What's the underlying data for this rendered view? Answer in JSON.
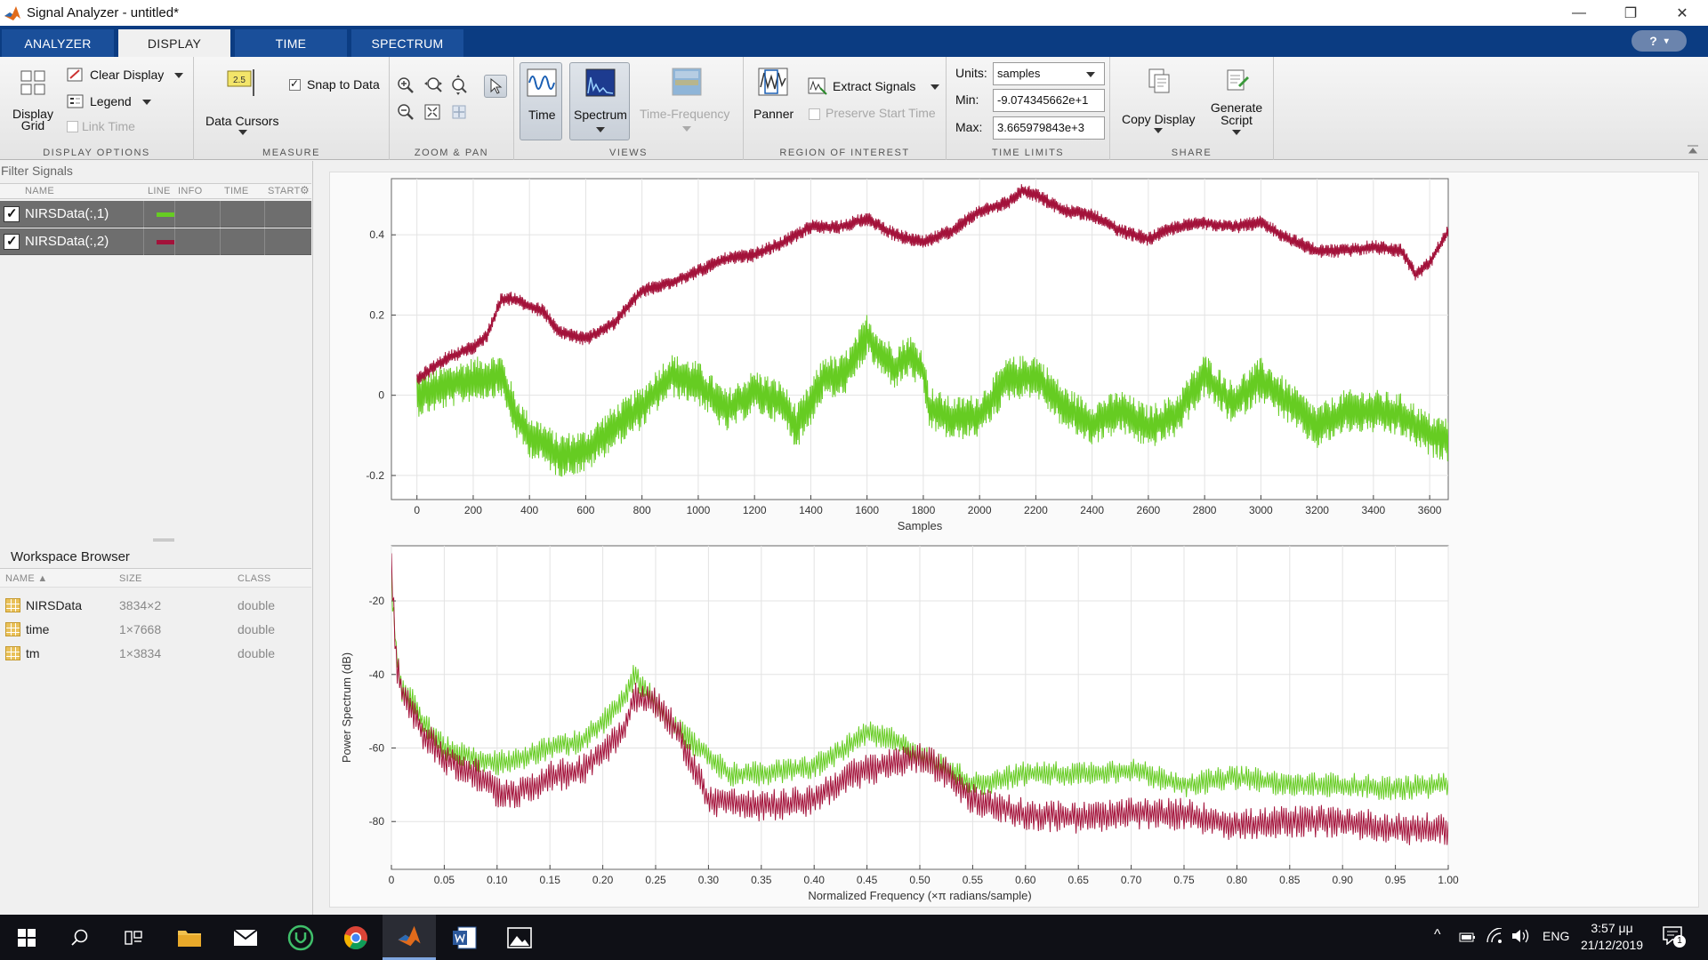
{
  "window": {
    "title": "Signal Analyzer - untitled*",
    "minimize": "—",
    "maximize": "❐",
    "close": "✕"
  },
  "tabs": [
    {
      "label": "ANALYZER",
      "active": false
    },
    {
      "label": "DISPLAY",
      "active": true
    },
    {
      "label": "TIME",
      "active": false
    },
    {
      "label": "SPECTRUM",
      "active": false
    }
  ],
  "help_icon": "?",
  "ribbon": {
    "display_options": {
      "label": "DISPLAY OPTIONS",
      "display_grid": "Display Grid",
      "clear_display": "Clear Display",
      "legend": "Legend",
      "link_time": "Link Time"
    },
    "measure": {
      "label": "MEASURE",
      "data_cursors": "Data Cursors",
      "cursor_badge": "2.5",
      "snap_to_data": "Snap to Data"
    },
    "zoom_pan": {
      "label": "ZOOM & PAN"
    },
    "views": {
      "label": "VIEWS",
      "time": "Time",
      "spectrum": "Spectrum",
      "time_frequency": "Time-Frequency"
    },
    "roi": {
      "label": "REGION OF INTEREST",
      "panner": "Panner",
      "extract_signals": "Extract Signals",
      "preserve_start_time": "Preserve Start Time"
    },
    "time_limits": {
      "label": "TIME LIMITS",
      "units_label": "Units:",
      "units_value": "samples",
      "min_label": "Min:",
      "min_value": "-9.074345662e+1",
      "max_label": "Max:",
      "max_value": "3.665979843e+3"
    },
    "share": {
      "label": "SHARE",
      "copy_display": "Copy Display",
      "generate_script_l1": "Generate",
      "generate_script_l2": "Script"
    }
  },
  "signals_panel": {
    "filter_placeholder": "Filter Signals",
    "columns": [
      "NAME",
      "LINE",
      "INFO",
      "TIME",
      "START"
    ],
    "rows": [
      {
        "name": "NIRSData(:,1)",
        "color": "#66cc22"
      },
      {
        "name": "NIRSData(:,2)",
        "color": "#a3123a"
      }
    ]
  },
  "workspace": {
    "title": "Workspace Browser",
    "columns": [
      "NAME ▲",
      "SIZE",
      "CLASS"
    ],
    "rows": [
      {
        "name": "NIRSData",
        "size": "3834×2",
        "class": "double"
      },
      {
        "name": "time",
        "size": "1×7668",
        "class": "double"
      },
      {
        "name": "tm",
        "size": "1×3834",
        "class": "double"
      }
    ]
  },
  "chart_data": [
    {
      "type": "line",
      "title": "",
      "xlabel": "Samples",
      "ylabel": "",
      "xlim": [
        -90.74,
        3666
      ],
      "ylim": [
        -0.26,
        0.54
      ],
      "xticks": [
        0,
        200,
        400,
        600,
        800,
        1000,
        1200,
        1400,
        1600,
        1800,
        2000,
        2200,
        2400,
        2600,
        2800,
        3000,
        3200,
        3400,
        3600
      ],
      "yticks": [
        -0.2,
        0,
        0.2,
        0.4
      ],
      "ytick_labels": [
        "-0.2",
        "0",
        "0.2",
        "0.4"
      ],
      "grid": true,
      "series": [
        {
          "color": "#66cc22",
          "noise_amplitude": 0.055,
          "x": [
            0,
            100,
            200,
            300,
            350,
            400,
            450,
            500,
            600,
            700,
            800,
            900,
            1000,
            1100,
            1200,
            1300,
            1350,
            1400,
            1450,
            1500,
            1550,
            1600,
            1650,
            1700,
            1750,
            1800,
            1820,
            1900,
            2000,
            2100,
            2200,
            2300,
            2400,
            2500,
            2600,
            2700,
            2800,
            2900,
            3000,
            3100,
            3200,
            3300,
            3400,
            3500,
            3600,
            3666
          ],
          "y": [
            0.0,
            0.02,
            0.04,
            0.05,
            -0.05,
            -0.1,
            -0.12,
            -0.15,
            -0.14,
            -0.08,
            -0.03,
            0.05,
            0.03,
            -0.04,
            0.01,
            -0.02,
            -0.08,
            -0.02,
            0.05,
            0.04,
            0.08,
            0.15,
            0.1,
            0.07,
            0.1,
            0.06,
            -0.03,
            -0.06,
            -0.05,
            0.04,
            0.05,
            -0.03,
            -0.07,
            -0.04,
            -0.08,
            -0.05,
            0.05,
            -0.02,
            0.04,
            -0.02,
            -0.08,
            -0.04,
            -0.04,
            -0.05,
            -0.1,
            -0.11
          ]
        },
        {
          "color": "#a3123a",
          "noise_amplitude": 0.018,
          "x": [
            0,
            100,
            200,
            250,
            300,
            350,
            400,
            450,
            500,
            600,
            700,
            800,
            900,
            1000,
            1100,
            1200,
            1300,
            1400,
            1500,
            1600,
            1700,
            1800,
            1900,
            2000,
            2100,
            2150,
            2200,
            2300,
            2400,
            2500,
            2600,
            2700,
            2800,
            2900,
            3000,
            3100,
            3200,
            3300,
            3400,
            3500,
            3550,
            3600,
            3666
          ],
          "y": [
            0.04,
            0.09,
            0.12,
            0.15,
            0.24,
            0.24,
            0.22,
            0.21,
            0.16,
            0.14,
            0.18,
            0.26,
            0.28,
            0.31,
            0.34,
            0.35,
            0.38,
            0.42,
            0.42,
            0.44,
            0.4,
            0.38,
            0.41,
            0.46,
            0.48,
            0.51,
            0.5,
            0.46,
            0.45,
            0.41,
            0.39,
            0.42,
            0.43,
            0.42,
            0.43,
            0.39,
            0.36,
            0.36,
            0.37,
            0.36,
            0.3,
            0.33,
            0.41
          ]
        }
      ]
    },
    {
      "type": "line",
      "title": "",
      "xlabel": "Normalized Frequency (×π radians/sample)",
      "ylabel": "Power Spectrum (dB)",
      "xlim": [
        0,
        1
      ],
      "ylim": [
        -93,
        -5
      ],
      "xticks": [
        0,
        0.05,
        0.1,
        0.15,
        0.2,
        0.25,
        0.3,
        0.35,
        0.4,
        0.45,
        0.5,
        0.55,
        0.6,
        0.65,
        0.7,
        0.75,
        0.8,
        0.85,
        0.9,
        0.95,
        1.0
      ],
      "xtick_labels": [
        "0",
        "0.05",
        "0.10",
        "0.15",
        "0.20",
        "0.25",
        "0.30",
        "0.35",
        "0.40",
        "0.45",
        "0.50",
        "0.55",
        "0.60",
        "0.65",
        "0.70",
        "0.75",
        "0.80",
        "0.85",
        "0.90",
        "0.95",
        "1.00"
      ],
      "yticks": [
        -80,
        -60,
        -40,
        -20
      ],
      "ytick_labels": [
        "-80",
        "-60",
        "-40",
        "-20"
      ],
      "grid": true,
      "series": [
        {
          "color": "#66cc22",
          "noise_amplitude": 3.5,
          "x": [
            0,
            0.005,
            0.01,
            0.02,
            0.03,
            0.05,
            0.08,
            0.1,
            0.12,
            0.15,
            0.18,
            0.2,
            0.22,
            0.23,
            0.25,
            0.27,
            0.3,
            0.32,
            0.35,
            0.38,
            0.4,
            0.43,
            0.45,
            0.48,
            0.5,
            0.53,
            0.55,
            0.6,
            0.65,
            0.7,
            0.75,
            0.8,
            0.85,
            0.9,
            0.95,
            1.0
          ],
          "y": [
            -15,
            -35,
            -44,
            -47,
            -53,
            -60,
            -63,
            -64,
            -63,
            -60,
            -58,
            -53,
            -47,
            -40,
            -48,
            -55,
            -62,
            -67,
            -67,
            -66,
            -65,
            -60,
            -56,
            -58,
            -62,
            -66,
            -70,
            -67,
            -67,
            -66,
            -70,
            -68,
            -70,
            -70,
            -71,
            -70
          ]
        },
        {
          "color": "#a3123a",
          "noise_amplitude": 4.5,
          "x": [
            0,
            0.005,
            0.01,
            0.02,
            0.03,
            0.05,
            0.08,
            0.1,
            0.12,
            0.15,
            0.18,
            0.2,
            0.22,
            0.23,
            0.25,
            0.27,
            0.3,
            0.32,
            0.35,
            0.38,
            0.4,
            0.43,
            0.45,
            0.48,
            0.5,
            0.53,
            0.55,
            0.6,
            0.65,
            0.7,
            0.75,
            0.8,
            0.85,
            0.9,
            0.95,
            1.0
          ],
          "y": [
            -10,
            -38,
            -45,
            -50,
            -56,
            -63,
            -67,
            -72,
            -72,
            -68,
            -66,
            -61,
            -55,
            -46,
            -48,
            -55,
            -74,
            -75,
            -76,
            -75,
            -74,
            -68,
            -66,
            -64,
            -62,
            -68,
            -74,
            -78,
            -79,
            -78,
            -78,
            -81,
            -80,
            -80,
            -82,
            -82
          ]
        }
      ]
    }
  ],
  "taskbar": {
    "language": "ENG",
    "time": "3:57 μμ",
    "date": "21/12/2019",
    "notifications": "1"
  }
}
